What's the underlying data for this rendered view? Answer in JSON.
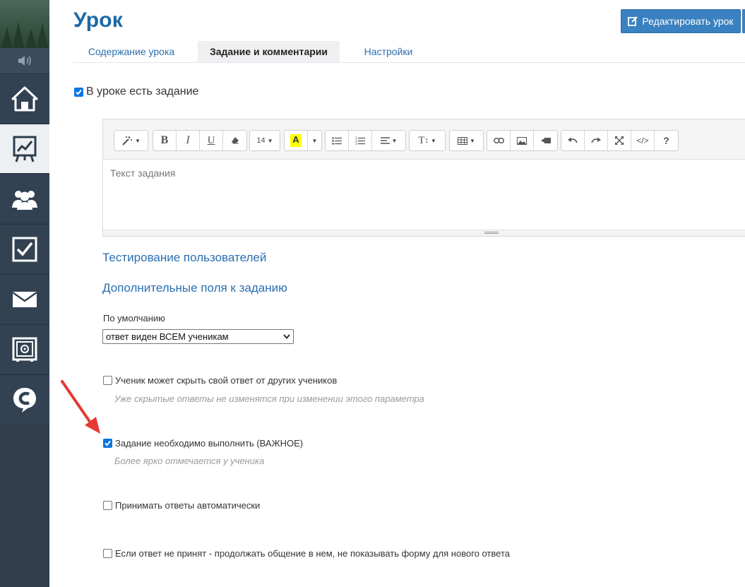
{
  "header": {
    "title": "Урок",
    "edit_button": "Редактировать урок"
  },
  "tabs": [
    {
      "label": "Содержание урока",
      "active": false
    },
    {
      "label": "Задание и комментарии",
      "active": true
    },
    {
      "label": "Настройки",
      "active": false
    }
  ],
  "has_task": {
    "label": "В уроке есть задание",
    "checked": true
  },
  "editor": {
    "font_size": "14",
    "placeholder": "Текст задания",
    "toolbar_icons": [
      "magic-icon",
      "bold-icon",
      "italic-icon",
      "underline-icon",
      "eraser-icon",
      "font-size-select",
      "highlight-icon",
      "bullet-list-icon",
      "numbered-list-icon",
      "align-icon",
      "line-height-icon",
      "table-icon",
      "link-icon",
      "image-icon",
      "video-icon",
      "undo-icon",
      "redo-icon",
      "fullscreen-icon",
      "code-view-icon",
      "help-icon"
    ]
  },
  "sections": {
    "user_testing": "Тестирование пользователей",
    "extra_fields": "Дополнительные поля к заданию"
  },
  "visibility": {
    "label": "По умолчанию",
    "selected": "ответ виден ВСЕМ ученикам"
  },
  "options": [
    {
      "label": "Ученик может скрыть свой ответ от других учеников",
      "checked": false,
      "hint": "Уже скрытые ответы не изменятся при изменении этого параметра"
    },
    {
      "label": "Задание необходимо выполнить (ВАЖНОЕ)",
      "checked": true,
      "hint": "Более ярко отмечается у ученика"
    },
    {
      "label": "Принимать ответы автоматически",
      "checked": false,
      "hint": ""
    },
    {
      "label": "Если ответ не принят - продолжать общение в нем, не показывать форму для нового ответа",
      "checked": false,
      "hint": ""
    }
  ],
  "colors": {
    "accent": "#1d69a8",
    "link": "#2a6fb0",
    "button": "#3a81c1",
    "sidebar": "#2f3d4c",
    "checkbox": "#0b75e3",
    "arrow": "#e53935"
  },
  "sidebar_icons": [
    "speaker-icon",
    "home-icon",
    "chart-board-icon",
    "users-icon",
    "checkbox-icon",
    "mail-icon",
    "safe-icon",
    "chat-c-icon"
  ]
}
